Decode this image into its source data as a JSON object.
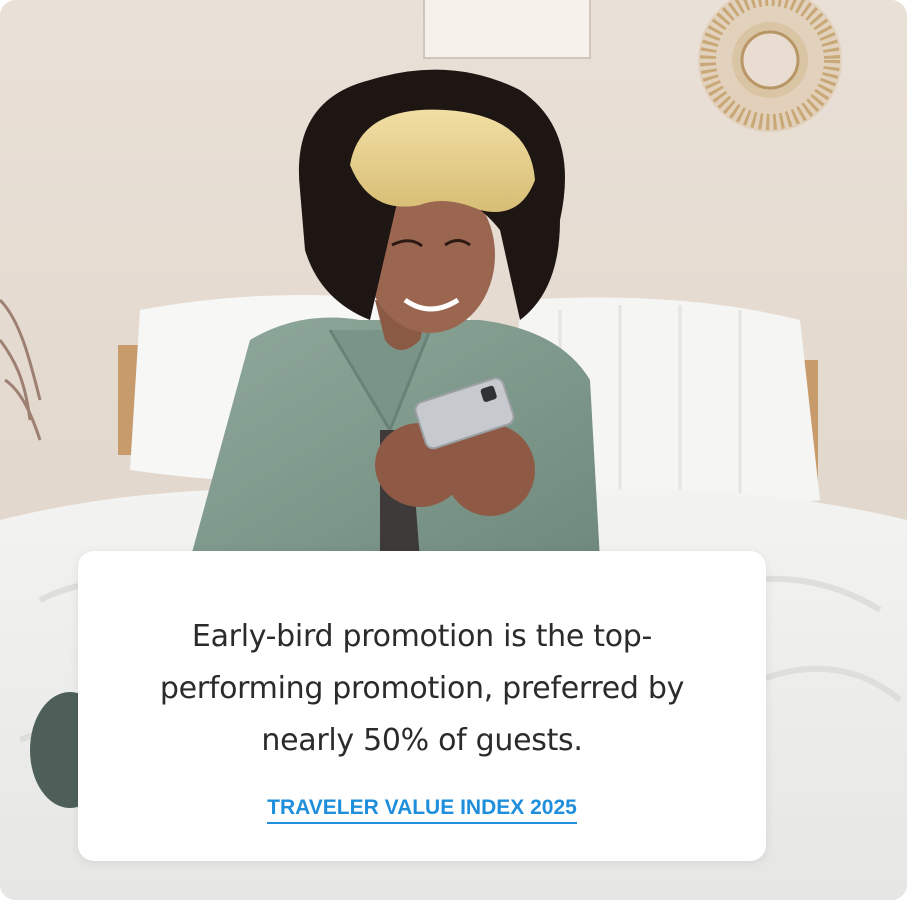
{
  "promo_card": {
    "headline": "Early-bird promotion is the top-performing promotion, preferred by nearly 50% of guests.",
    "source_link": "TRAVELER VALUE INDEX 2025",
    "link_color": "#1f8fdc"
  },
  "photo": {
    "subject": "woman-with-eye-mask-on-bed-using-phone-photo"
  }
}
